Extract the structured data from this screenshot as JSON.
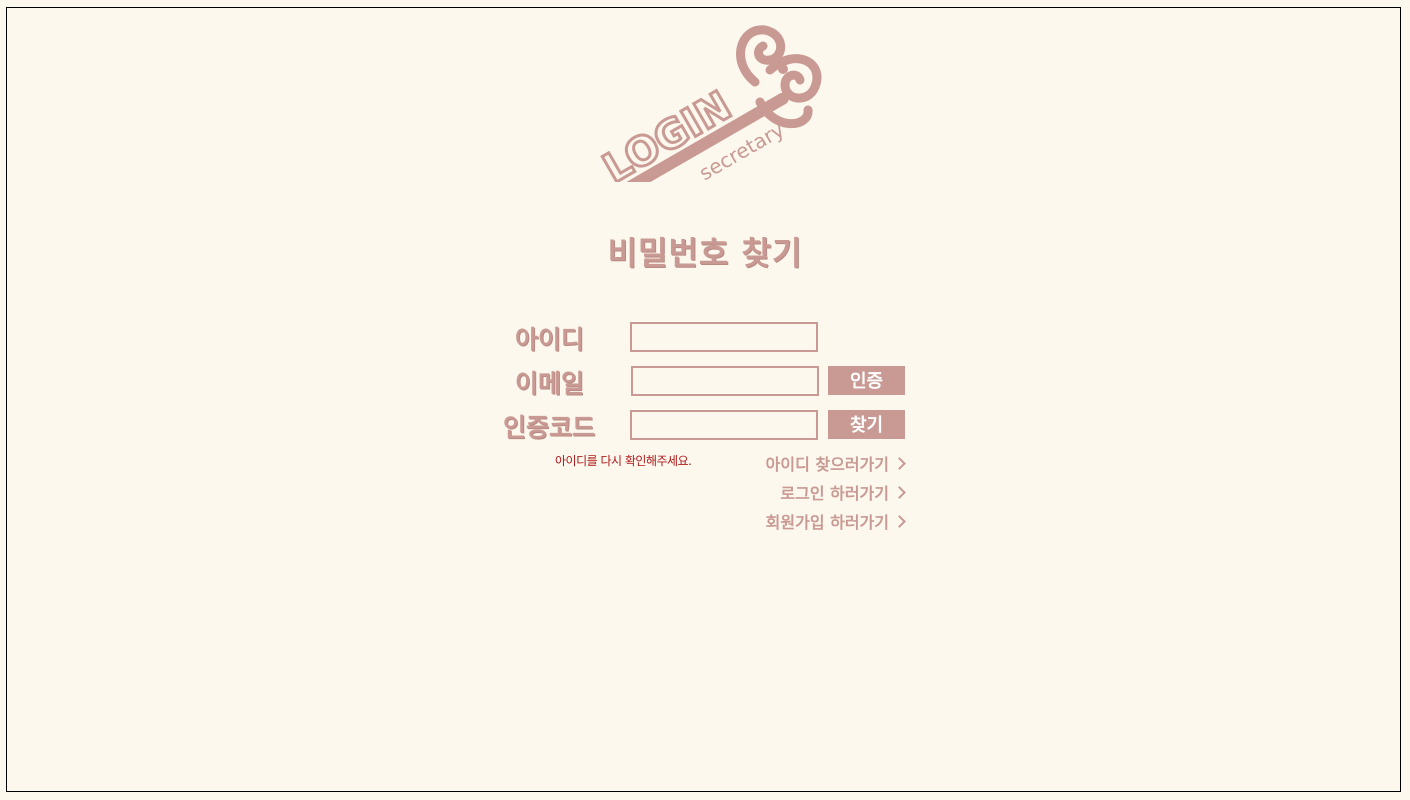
{
  "page": {
    "title": "비밀번호 찾기"
  },
  "logo": {
    "main_text": "LOGIN",
    "sub_text": "secretary"
  },
  "form": {
    "id_label": "아이디",
    "id_value": "",
    "email_label": "이메일",
    "email_value": "",
    "code_label": "인증코드",
    "code_value": "",
    "verify_button": "인증",
    "find_button": "찾기",
    "error_message": "아이디를 다시 확인해주세요."
  },
  "links": {
    "find_id": "아이디 찾으러가기",
    "login": "로그인 하러가기",
    "signup": "회원가입 하러가기"
  },
  "colors": {
    "background": "#fcf8ee",
    "accent": "#c99a93",
    "error": "#b01818"
  },
  "icons": {
    "logo": "key-icon",
    "link_arrow": "chevron-right-icon"
  }
}
